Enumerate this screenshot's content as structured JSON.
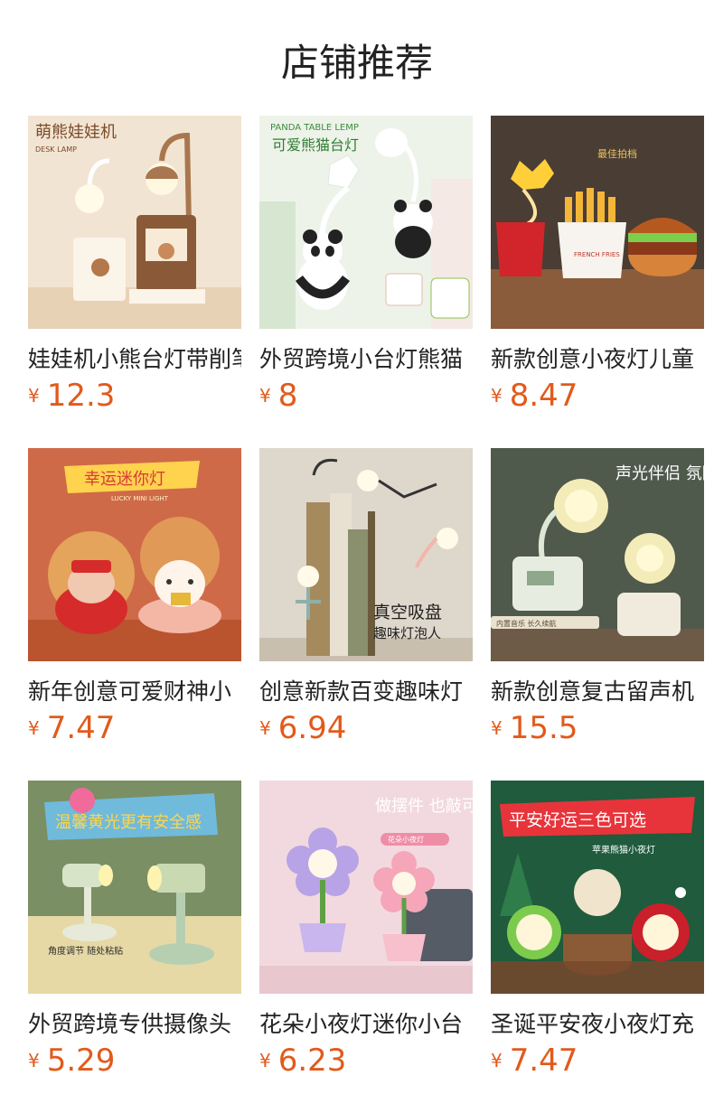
{
  "page": {
    "title": "店铺推荐"
  },
  "currency": "¥",
  "products": [
    {
      "name": "娃娃机小熊台灯带削笔",
      "price": "12.3",
      "img_text": "萌熊娃娃机",
      "img_sub": "DESK LAMP"
    },
    {
      "name": "外贸跨境小台灯熊猫",
      "price": "8",
      "img_text": "可爱熊猫台灯",
      "img_sub": "PANDA TABLE LEMP"
    },
    {
      "name": "新款创意小夜灯儿童",
      "price": "8.47",
      "img_text": "最佳拍档",
      "img_sub": "FRENCH FRIES"
    },
    {
      "name": "新年创意可爱财神小",
      "price": "7.47",
      "img_text": "幸运迷你灯",
      "img_sub": "LUCKY MINI LIGHT"
    },
    {
      "name": "创意新款百变趣味灯",
      "price": "6.94",
      "img_text": "真空吸盘",
      "img_sub": "趣味灯泡人"
    },
    {
      "name": "新款创意复古留声机",
      "price": "15.5",
      "img_text": "声光伴侣 氛围营造",
      "img_sub": "内置音乐 长久续航"
    },
    {
      "name": "外贸跨境专供摄像头",
      "price": "5.29",
      "img_text": "温馨黄光更有安全感",
      "img_sub": "角度调节 随处粘贴"
    },
    {
      "name": "花朵小夜灯迷你小台",
      "price": "6.23",
      "img_text": "做摆件 也敲可爱",
      "img_sub": "花朵小夜灯"
    },
    {
      "name": "圣诞平安夜小夜灯充",
      "price": "7.47",
      "img_text": "平安好运三色可选",
      "img_sub": "苹果熊猫小夜灯"
    }
  ],
  "colors": {
    "price": "#e25a1b",
    "title": "#222222"
  }
}
